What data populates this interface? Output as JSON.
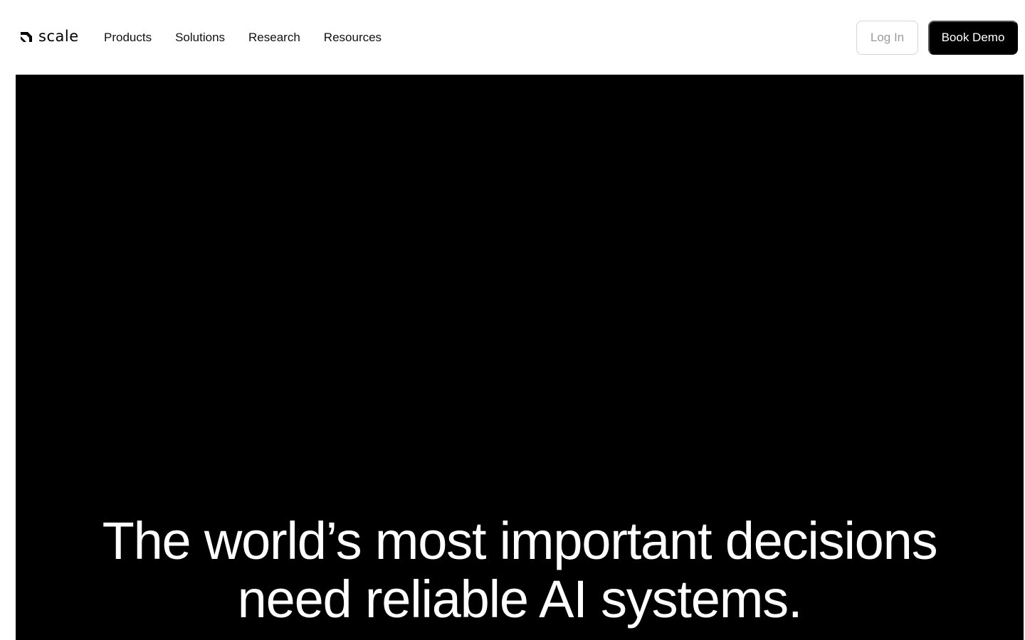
{
  "brand": {
    "name": "scale",
    "icon": "scale-logo-mark-icon"
  },
  "nav": {
    "items": [
      {
        "label": "Products"
      },
      {
        "label": "Solutions"
      },
      {
        "label": "Research"
      },
      {
        "label": "Resources"
      }
    ]
  },
  "auth": {
    "login_label": "Log In",
    "demo_label": "Book Demo"
  },
  "hero": {
    "headline_line1": "The world’s most important decisions",
    "headline_line2": "need reliable AI systems."
  },
  "colors": {
    "background": "#ffffff",
    "hero_background": "#000000",
    "hero_text": "#ffffff",
    "primary_button": "#000000",
    "secondary_button_border": "#d7d7d7"
  }
}
